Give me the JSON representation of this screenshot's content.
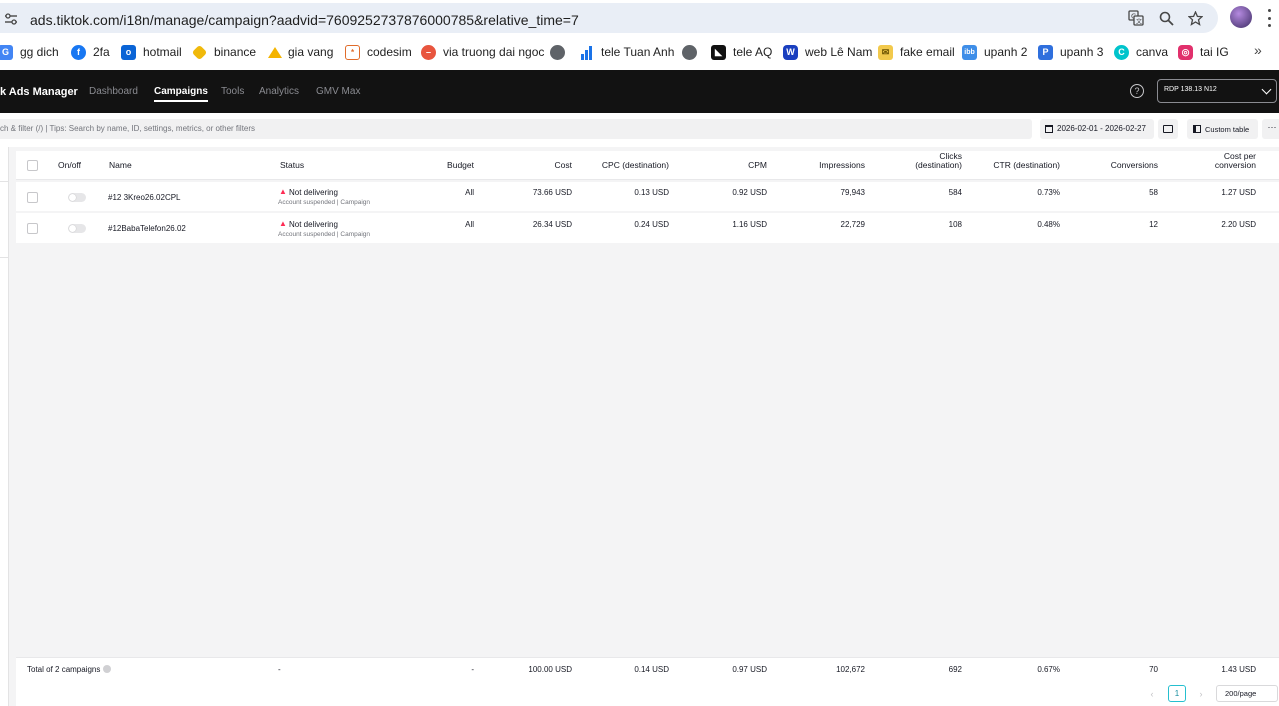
{
  "browser": {
    "url": "ads.tiktok.com/i18n/manage/campaign?aadvid=7609252737876000785&relative_time=7",
    "icons": [
      "site-settings-icon",
      "translate-icon",
      "zoom-icon",
      "bookmark-star-icon",
      "profile-avatar",
      "browser-menu-icon"
    ]
  },
  "bookmarks": [
    {
      "label": "gg dich",
      "color": "#4285f4"
    },
    {
      "label": "2fa",
      "color": "#1877f2"
    },
    {
      "label": "hotmail",
      "color": "#0a64d6"
    },
    {
      "label": "binance",
      "color": "#f0b90b"
    },
    {
      "label": "gia vang",
      "color": "#f4b400"
    },
    {
      "label": "codesim",
      "color": "#e06c2b"
    },
    {
      "label": "via truong dai ngoc",
      "color": "#e8553e"
    },
    {
      "label": "",
      "color": "#5f6368"
    },
    {
      "label": "tele Tuan Anh",
      "color": "#1a73e8"
    },
    {
      "label": "",
      "color": "#5f6368"
    },
    {
      "label": "tele AQ",
      "color": "#111111"
    },
    {
      "label": "web Lê Nam",
      "color": "#1a3fbf"
    },
    {
      "label": "fake email",
      "color": "#f2c94c"
    },
    {
      "label": "upanh 2",
      "color": "#3f8ee8"
    },
    {
      "label": "upanh 3",
      "color": "#2f6fdd"
    },
    {
      "label": "canva",
      "color": "#00c4cc"
    },
    {
      "label": "tai IG",
      "color": "#e1306c"
    }
  ],
  "nav": {
    "brand": "k Ads Manager",
    "items": [
      "Dashboard",
      "Campaigns",
      "Tools",
      "Analytics",
      "GMV Max"
    ],
    "active": "Campaigns",
    "account": "RDP 138.13 N12"
  },
  "filter": {
    "search_placeholder": "ch & filter (/) | Tips: Search by name, ID, settings, metrics, or other filters",
    "date_range": "2026-02-01 - 2026-02-27",
    "custom_table": "Custom table",
    "more": "···"
  },
  "table": {
    "headers": {
      "onoff": "On/off",
      "name": "Name",
      "status": "Status",
      "budget": "Budget",
      "cost": "Cost",
      "cpc": "CPC (destination)",
      "cpm": "CPM",
      "impressions": "Impressions",
      "clicks_1": "Clicks",
      "clicks_2": "(destination)",
      "ctr": "CTR (destination)",
      "conversions": "Conversions",
      "cpconv_1": "Cost per",
      "cpconv_2": "conversion"
    },
    "rows": [
      {
        "name": "#12 3Kreo26.02CPL",
        "status": "Not delivering",
        "status_sub": "Account suspended | Campaign",
        "budget": "All",
        "cost": "73.66 USD",
        "cpc": "0.13 USD",
        "cpm": "0.92 USD",
        "impressions": "79,943",
        "clicks": "584",
        "ctr": "0.73%",
        "conversions": "58",
        "cost_per_conversion": "1.27 USD"
      },
      {
        "name": "#12BabaTelefon26.02",
        "status": "Not delivering",
        "status_sub": "Account suspended | Campaign",
        "budget": "All",
        "cost": "26.34 USD",
        "cpc": "0.24 USD",
        "cpm": "1.16 USD",
        "impressions": "22,729",
        "clicks": "108",
        "ctr": "0.48%",
        "conversions": "12",
        "cost_per_conversion": "2.20 USD"
      }
    ],
    "total": {
      "label": "Total of 2 campaigns",
      "status": "-",
      "budget": "-",
      "cost": "100.00 USD",
      "cpc": "0.14 USD",
      "cpm": "0.97 USD",
      "impressions": "102,672",
      "clicks": "692",
      "ctr": "0.67%",
      "conversions": "70",
      "cost_per_conversion": "1.43 USD"
    }
  },
  "pagination": {
    "prev": "‹",
    "current_page": "1",
    "next": "›",
    "page_size": "200/page"
  },
  "colors": {
    "nav_bg": "#121212",
    "warning": "#fe2c55",
    "page_accent": "#25bfcf"
  }
}
